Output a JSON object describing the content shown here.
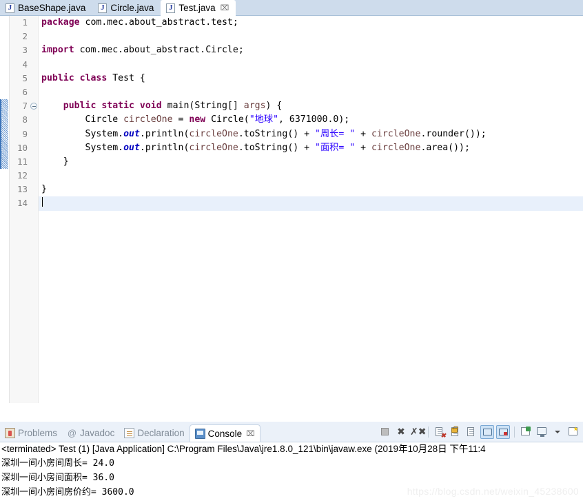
{
  "editor": {
    "tabs": [
      {
        "label": "BaseShape.java",
        "icon": "java-file-icon",
        "active": false,
        "closable": false
      },
      {
        "label": "Circle.java",
        "icon": "java-file-icon",
        "active": false,
        "closable": false
      },
      {
        "label": "Test.java",
        "icon": "java-file-icon",
        "active": true,
        "closable": true,
        "close_glyph": "⌧"
      }
    ],
    "line_numbers": [
      "1",
      "2",
      "3",
      "4",
      "5",
      "6",
      "7",
      "8",
      "9",
      "10",
      "11",
      "12",
      "13",
      "14"
    ],
    "current_line": 14,
    "fold_marker_line": 7,
    "change_bar_lines": [
      7,
      8,
      9,
      10,
      11
    ],
    "scroll_left_arrow": "‹",
    "lines": [
      {
        "n": 1,
        "tokens": [
          {
            "t": "package",
            "c": "kw"
          },
          {
            "t": " com.mec.about_abstract.test;",
            "c": "pln"
          }
        ]
      },
      {
        "n": 2,
        "tokens": []
      },
      {
        "n": 3,
        "tokens": [
          {
            "t": "import",
            "c": "kw"
          },
          {
            "t": " com.mec.about_abstract.Circle;",
            "c": "pln"
          }
        ]
      },
      {
        "n": 4,
        "tokens": []
      },
      {
        "n": 5,
        "tokens": [
          {
            "t": "public class",
            "c": "kw"
          },
          {
            "t": " Test {",
            "c": "pln"
          }
        ]
      },
      {
        "n": 6,
        "tokens": []
      },
      {
        "n": 7,
        "tokens": [
          {
            "t": "    ",
            "c": "pln"
          },
          {
            "t": "public static void",
            "c": "kw"
          },
          {
            "t": " main(String[] ",
            "c": "pln"
          },
          {
            "t": "args",
            "c": "lv"
          },
          {
            "t": ") {",
            "c": "pln"
          }
        ]
      },
      {
        "n": 8,
        "tokens": [
          {
            "t": "        Circle ",
            "c": "pln"
          },
          {
            "t": "circleOne",
            "c": "lv"
          },
          {
            "t": " = ",
            "c": "pln"
          },
          {
            "t": "new",
            "c": "kw"
          },
          {
            "t": " Circle(",
            "c": "pln"
          },
          {
            "t": "\"地球\"",
            "c": "str"
          },
          {
            "t": ", 6371000.0);",
            "c": "pln"
          }
        ]
      },
      {
        "n": 9,
        "tokens": [
          {
            "t": "        System.",
            "c": "pln"
          },
          {
            "t": "out",
            "c": "fld"
          },
          {
            "t": ".println(",
            "c": "pln"
          },
          {
            "t": "circleOne",
            "c": "lv"
          },
          {
            "t": ".toString() + ",
            "c": "pln"
          },
          {
            "t": "\"周长= \"",
            "c": "str"
          },
          {
            "t": " + ",
            "c": "pln"
          },
          {
            "t": "circleOne",
            "c": "lv"
          },
          {
            "t": ".rounder());",
            "c": "pln"
          }
        ]
      },
      {
        "n": 10,
        "tokens": [
          {
            "t": "        System.",
            "c": "pln"
          },
          {
            "t": "out",
            "c": "fld"
          },
          {
            "t": ".println(",
            "c": "pln"
          },
          {
            "t": "circleOne",
            "c": "lv"
          },
          {
            "t": ".toString() + ",
            "c": "pln"
          },
          {
            "t": "\"面积= \"",
            "c": "str"
          },
          {
            "t": " + ",
            "c": "pln"
          },
          {
            "t": "circleOne",
            "c": "lv"
          },
          {
            "t": ".area());",
            "c": "pln"
          }
        ]
      },
      {
        "n": 11,
        "tokens": [
          {
            "t": "    }",
            "c": "pln"
          }
        ]
      },
      {
        "n": 12,
        "tokens": []
      },
      {
        "n": 13,
        "tokens": [
          {
            "t": "}",
            "c": "pln"
          }
        ]
      },
      {
        "n": 14,
        "tokens": []
      }
    ]
  },
  "bottom_panel": {
    "tabs": [
      {
        "label": "Problems",
        "icon": "problems-icon",
        "active": false,
        "closable": false
      },
      {
        "label": "Javadoc",
        "icon": "javadoc-icon",
        "active": false,
        "closable": false
      },
      {
        "label": "Declaration",
        "icon": "declaration-icon",
        "active": false,
        "closable": false
      },
      {
        "label": "Console",
        "icon": "console-icon",
        "active": true,
        "closable": true,
        "close_glyph": "⌧"
      }
    ],
    "toolbar": [
      {
        "name": "terminate-button",
        "glyph": "stop",
        "pressed": false
      },
      {
        "name": "remove-launch-button",
        "glyph": "x",
        "pressed": false
      },
      {
        "name": "remove-all-terminated-button",
        "glyph": "xx",
        "pressed": false
      },
      {
        "name": "separator-1",
        "glyph": "sep",
        "pressed": false
      },
      {
        "name": "clear-console-button",
        "glyph": "clear",
        "pressed": false
      },
      {
        "name": "lock-console-button",
        "glyph": "lock",
        "pressed": false
      },
      {
        "name": "scroll-lock-button",
        "glyph": "scroll",
        "pressed": false
      },
      {
        "name": "show-console-on-output-button",
        "glyph": "stdout",
        "pressed": true
      },
      {
        "name": "show-console-on-error-button",
        "glyph": "stderr",
        "pressed": true
      },
      {
        "name": "separator-2",
        "glyph": "sep",
        "pressed": false
      },
      {
        "name": "pin-console-button",
        "glyph": "pin",
        "pressed": false
      },
      {
        "name": "display-selected-console-button",
        "glyph": "monitor",
        "pressed": false
      },
      {
        "name": "console-menu-dropdown",
        "glyph": "caret",
        "pressed": false
      },
      {
        "name": "open-console-button",
        "glyph": "newcon",
        "pressed": false
      }
    ],
    "console": {
      "title": "<terminated> Test (1) [Java Application] C:\\Program Files\\Java\\jre1.8.0_121\\bin\\javaw.exe (2019年10月28日 下午11:4",
      "output_lines": [
        "深圳一间小房间周长= 24.0",
        "深圳一间小房间面积= 36.0",
        "深圳一间小房间房价约= 3600.0"
      ]
    }
  },
  "watermark": {
    "text": "https://blog.csdn.net/weixin_45238600"
  },
  "colors": {
    "tabbar_bg": "#cedcec",
    "gutter_bg": "#f7f7f7",
    "current_line": "#e8f0fb",
    "keyword": "#7f0055",
    "string": "#2a00ff",
    "field": "#0000c0",
    "local_var": "#6a3e3e",
    "viewbar_bg": "#ebf1f9",
    "pressed_button": "#cde2f6"
  }
}
